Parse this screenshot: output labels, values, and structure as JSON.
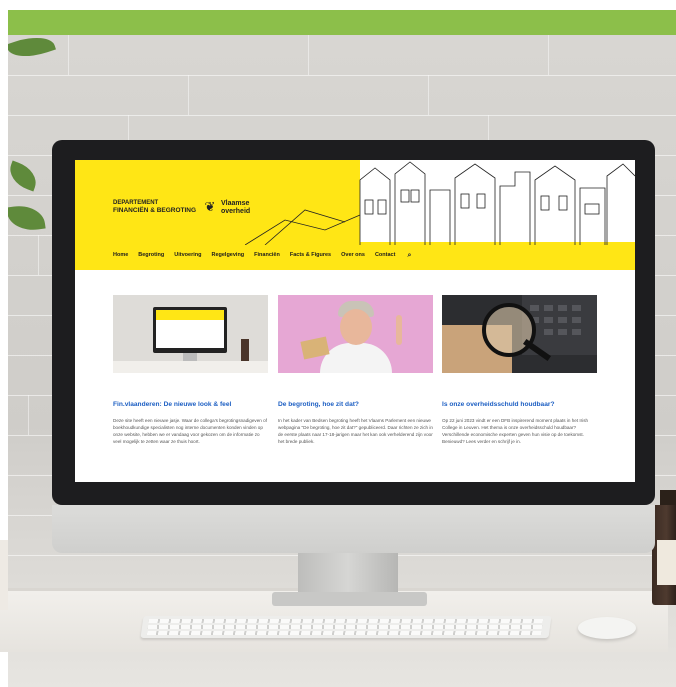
{
  "site": {
    "brand_line1": "DEPARTEMENT",
    "brand_line2": "FINANCIËN & BEGROTING",
    "logo_text_line1": "Vlaamse",
    "logo_text_line2": "overheid",
    "accent_color": "#ffe615",
    "link_color": "#1d5fc3",
    "banner_color": "#8cbf4a"
  },
  "nav": {
    "items": [
      "Home",
      "Begroting",
      "Uitvoering",
      "Regelgeving",
      "Financiën",
      "Facts & Figures",
      "Over ons",
      "Contact"
    ],
    "search_icon": "search-icon"
  },
  "cards": [
    {
      "title": "Fin.vlaanderen: De nieuwe look & feel",
      "text": "Deze site heeft een nieuwe jasje. Waar de collega's begrotingsnadigeven of boekhoudkundige specialisten nog interne documenten konden vinden op onze website, hebben we er vandaag voor gekozen om de informatie zo veel mogelijk te zetten waar ze thuis hoort."
    },
    {
      "title": "De begroting, hoe zit dat?",
      "text": "In het kader van Bedsen begroting heeft het Vlaams Parlement een nieuwe webpagina \"De begroting, hoe zit dat?\" gepubliceerd. Daar richten ze zich in de eerste plaats naar 17-18-jarigen maar het kan ook verhelderend zijn voor het brede publiek."
    },
    {
      "title": "Is onze overheidsschuld houdbaar?",
      "text": "Op 22 juni 2023 vindt er een DFB inspirerend moment plaats in het Irish College in Leuven. Het thema is onze overheidsschuld houdbaar? Verschillende economische experten geven hun visie op de toekomst. Benieuwd? Lees verder en schrijf je in."
    }
  ]
}
